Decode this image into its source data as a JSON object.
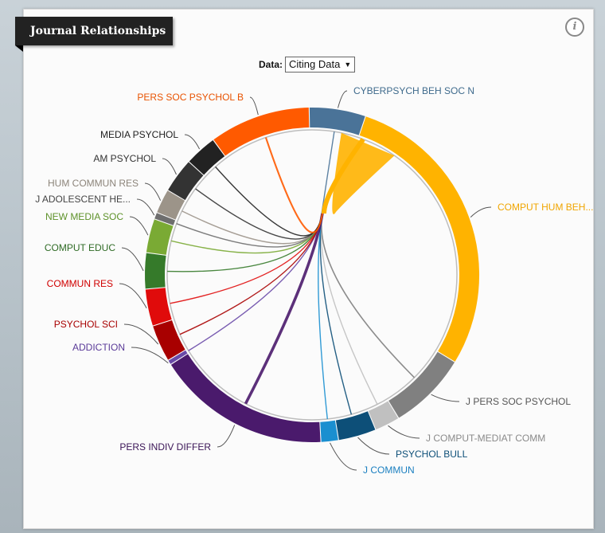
{
  "header": {
    "title": "Journal Relationships",
    "info_icon": "info-icon",
    "info_glyph": "i"
  },
  "data_selector": {
    "label": "Data:",
    "selected": "Citing Data",
    "caret": "▼"
  },
  "chart_data": {
    "type": "chord",
    "title": "Journal Relationships",
    "focus_journal": "COMPUT HUM BEH...",
    "arc_units": "share of citing data (percent of circle)",
    "journals": [
      {
        "label": "CYBERPSYCH BEH SOC N",
        "share": 5.8,
        "color": "#4a7398",
        "label_color": "#3e6a8c"
      },
      {
        "label": "COMPUT HUM BEH...",
        "share": 30.3,
        "color": "#ffb300",
        "label_color": "#f0a500"
      },
      {
        "label": "J PERS SOC PSYCHOL",
        "share": 8.1,
        "color": "#808080",
        "label_color": "#555555"
      },
      {
        "label": "J COMPUT-MEDIAT COMM",
        "share": 2.6,
        "color": "#c0c0c0",
        "label_color": "#8a8a8a"
      },
      {
        "label": "PSYCHOL BULL",
        "share": 3.9,
        "color": "#0d4f78",
        "label_color": "#0d4f78"
      },
      {
        "label": "J COMMUN",
        "share": 1.8,
        "color": "#1a8fd0",
        "label_color": "#1a7fc0"
      },
      {
        "label": "PERS INDIV DIFFER",
        "share": 17.9,
        "color": "#4a1a6c",
        "label_color": "#3a1456"
      },
      {
        "label": "ADDICTION",
        "share": 0.5,
        "color": "#6a4aa8",
        "label_color": "#5a3a98"
      },
      {
        "label": "PSYCHOL SCI",
        "share": 3.8,
        "color": "#a80000",
        "label_color": "#a80000"
      },
      {
        "label": "COMMUN RES",
        "share": 3.8,
        "color": "#e00b0b",
        "label_color": "#d00000"
      },
      {
        "label": "COMPUT EDUC",
        "share": 3.7,
        "color": "#357a2a",
        "label_color": "#2f6b25"
      },
      {
        "label": "NEW MEDIA SOC",
        "share": 3.5,
        "color": "#7aaa34",
        "label_color": "#5e922a"
      },
      {
        "label": "J ADOLESCENT HE...",
        "share": 0.7,
        "color": "#6e6e6e",
        "label_color": "#444444"
      },
      {
        "label": "HUM COMMUN RES",
        "share": 2.5,
        "color": "#9c9489",
        "label_color": "#8c847a"
      },
      {
        "label": "AM PSYCHOL",
        "share": 3.6,
        "color": "#333333",
        "label_color": "#333333"
      },
      {
        "label": "MEDIA PSYCHOL",
        "share": 3.3,
        "color": "#222222",
        "label_color": "#222222"
      },
      {
        "label": "PERS SOC PSYCHOL B",
        "share": 10.4,
        "color": "#ff5a00",
        "label_color": "#e85200"
      }
    ]
  }
}
